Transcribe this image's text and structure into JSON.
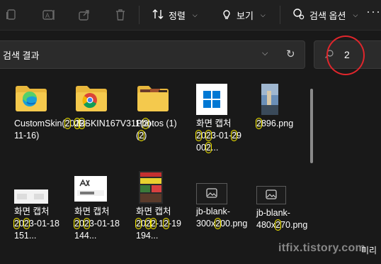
{
  "toolbar": {
    "sort_label": "정렬",
    "view_label": "보기",
    "search_options_label": "검색 옵션",
    "more_label": "···"
  },
  "address": {
    "text": "검색 결과"
  },
  "search": {
    "value": "2"
  },
  "files": [
    {
      "label": "CustomSkin(2022-11-16)",
      "type": "folder-edge"
    },
    {
      "label": "JBSKIN167V311(2)",
      "type": "folder-chrome"
    },
    {
      "label": "Photos (1) (2)",
      "type": "folder-photos"
    },
    {
      "label": "화면 캡처 2023-01-29 002...",
      "type": "image-windows"
    },
    {
      "label": "2896.png",
      "type": "image-photo"
    },
    {
      "label": "화면 캡처 2023-01-18 151...",
      "type": "image-white"
    },
    {
      "label": "화면 캡처 2023-01-18 144...",
      "type": "image-capslock"
    },
    {
      "label": "화면 캡처 2022-12-19 194...",
      "type": "image-dark"
    },
    {
      "label": "jb-blank-300x200.png",
      "type": "image-blank"
    },
    {
      "label": "jb-blank-480x270.png",
      "type": "image-blank"
    }
  ],
  "preview_pane": {
    "label": "미리"
  },
  "watermark": "itfix.tistory.com",
  "colors": {
    "background": "#191919",
    "toolbar": "#202020",
    "highlight": "#f2e600",
    "annotation_circle": "#e0262c",
    "folder": "#f4c94d"
  }
}
